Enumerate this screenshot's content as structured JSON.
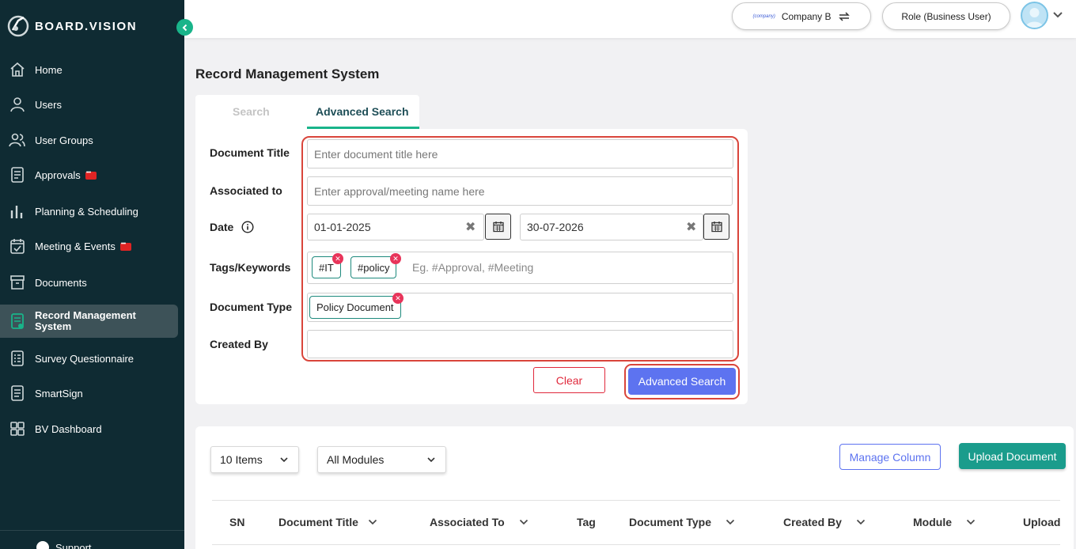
{
  "brand": {
    "name": "BOARD.VISION"
  },
  "sidebar": {
    "items": [
      {
        "label": "Home",
        "icon": "home-icon"
      },
      {
        "label": "Users",
        "icon": "user-icon"
      },
      {
        "label": "User Groups",
        "icon": "users-icon"
      },
      {
        "label": "Approvals",
        "icon": "document-icon",
        "badge": true
      },
      {
        "label": "Planning & Scheduling",
        "icon": "bar-chart-icon"
      },
      {
        "label": "Meeting & Events",
        "icon": "calendar-check-icon",
        "badge": true
      },
      {
        "label": "Documents",
        "icon": "archive-icon"
      },
      {
        "label": "Record Management System",
        "icon": "record-icon",
        "active": true
      },
      {
        "label": "Survey Questionnaire",
        "icon": "survey-icon"
      },
      {
        "label": "SmartSign",
        "icon": "sign-icon"
      },
      {
        "label": "BV Dashboard",
        "icon": "grid-icon"
      }
    ],
    "support_label": "Support"
  },
  "topbar": {
    "company": "Company B",
    "company_tag": "(company)",
    "role": "Role (Business User)"
  },
  "page": {
    "title": "Record Management System"
  },
  "tabs": [
    {
      "label": "Search",
      "active": false
    },
    {
      "label": "Advanced Search",
      "active": true
    }
  ],
  "form": {
    "document_title": {
      "label": "Document Title",
      "placeholder": "Enter document title here"
    },
    "associated_to": {
      "label": "Associated to",
      "placeholder": "Enter approval/meeting name here"
    },
    "date": {
      "label": "Date",
      "from": "01-01-2025",
      "to": "30-07-2026"
    },
    "tags": {
      "label": "Tags/Keywords",
      "chips": [
        "#IT",
        "#policy"
      ],
      "placeholder": "Eg. #Approval, #Meeting"
    },
    "document_type": {
      "label": "Document Type",
      "chips": [
        "Policy Document"
      ]
    },
    "created_by": {
      "label": "Created By",
      "value": ""
    },
    "clear_label": "Clear",
    "submit_label": "Advanced Search"
  },
  "results": {
    "items_select": "10 Items",
    "module_select": "All Modules",
    "manage_column_label": "Manage Column",
    "upload_label": "Upload Document",
    "columns": [
      "SN",
      "Document Title",
      "Associated To",
      "Tag",
      "Document Type",
      "Created By",
      "Module",
      "Upload"
    ]
  },
  "colors": {
    "sidebar_bg": "#0f2b33",
    "accent_green": "#19b48a",
    "primary_blue": "#5d73f0",
    "teal_button": "#1a9c8c",
    "highlight_red": "#d9453b"
  }
}
